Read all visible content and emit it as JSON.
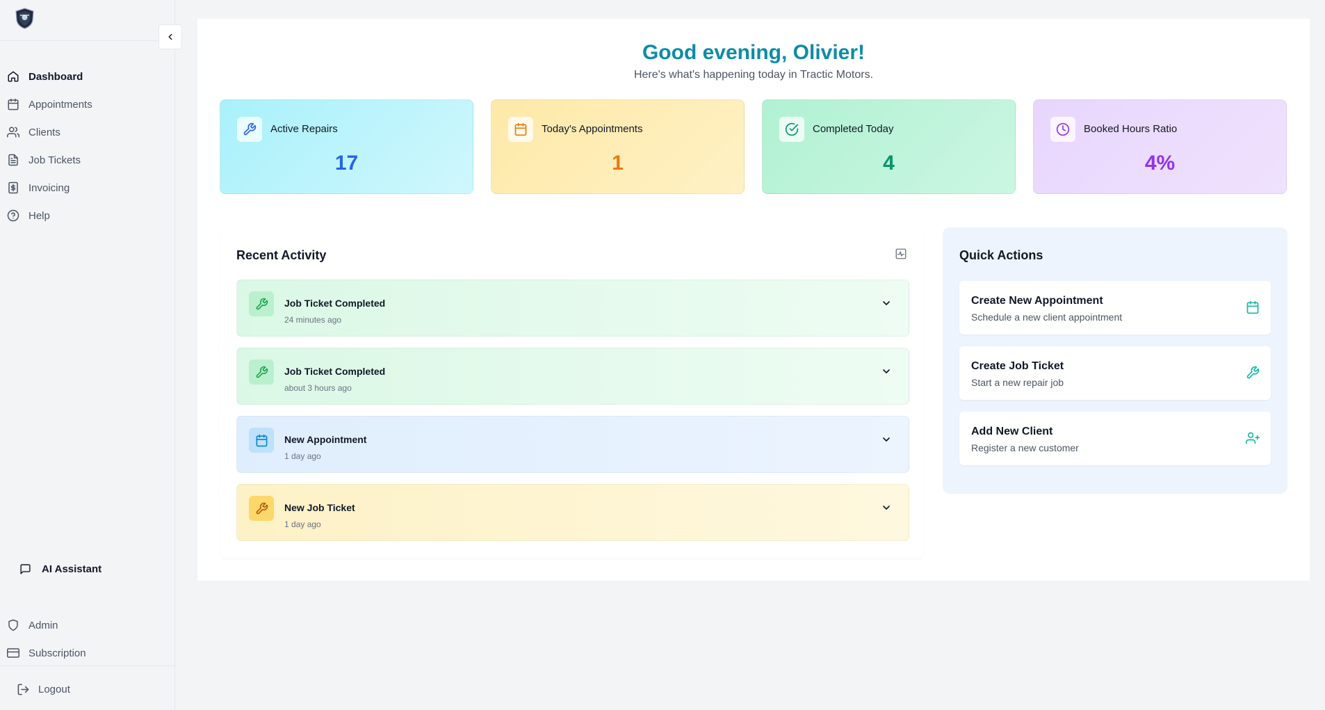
{
  "sidebar": {
    "logo_icon": "shield-badge-logo",
    "collapse_icon": "chevron-left-icon",
    "items": [
      {
        "label": "Dashboard",
        "icon": "home-icon",
        "active": true
      },
      {
        "label": "Appointments",
        "icon": "calendar-icon"
      },
      {
        "label": "Clients",
        "icon": "users-icon"
      },
      {
        "label": "Job Tickets",
        "icon": "file-text-icon"
      },
      {
        "label": "Invoicing",
        "icon": "dollar-icon"
      },
      {
        "label": "Help",
        "icon": "help-circle-icon"
      }
    ],
    "ai_assistant": "AI Assistant",
    "bottom_items": [
      {
        "label": "Admin",
        "icon": "shield-icon"
      },
      {
        "label": "Subscription",
        "icon": "credit-card-icon"
      }
    ],
    "logout": "Logout"
  },
  "header": {
    "greeting": "Good evening, Olivier!",
    "subtitle": "Here's what's happening today in Tractic Motors."
  },
  "stats": [
    {
      "label": "Active Repairs",
      "value": "17",
      "icon": "wrench-icon",
      "color": "#2563eb"
    },
    {
      "label": "Today's Appointments",
      "value": "1",
      "icon": "calendar-icon",
      "color": "#ea7a0c"
    },
    {
      "label": "Completed Today",
      "value": "4",
      "icon": "check-circle-icon",
      "color": "#059669"
    },
    {
      "label": "Booked Hours Ratio",
      "value": "4%",
      "icon": "clock-icon",
      "color": "#9333ea"
    }
  ],
  "recent_activity": {
    "title": "Recent Activity",
    "items": [
      {
        "title": "Job Ticket Completed",
        "time": "24 minutes ago",
        "icon": "wrench-icon"
      },
      {
        "title": "Job Ticket Completed",
        "time": "about 3 hours ago",
        "icon": "wrench-icon"
      },
      {
        "title": "New Appointment",
        "time": "1 day ago",
        "icon": "calendar-icon"
      },
      {
        "title": "New Job Ticket",
        "time": "1 day ago",
        "icon": "wrench-icon"
      }
    ]
  },
  "quick_actions": {
    "title": "Quick Actions",
    "items": [
      {
        "title": "Create New Appointment",
        "subtitle": "Schedule a new client appointment",
        "icon": "calendar-icon"
      },
      {
        "title": "Create Job Ticket",
        "subtitle": "Start a new repair job",
        "icon": "wrench-icon"
      },
      {
        "title": "Add New Client",
        "subtitle": "Register a new customer",
        "icon": "user-plus-icon"
      }
    ]
  },
  "colors": {
    "accent": "#0e8ca6",
    "quick_icon": "#14b8a6"
  }
}
